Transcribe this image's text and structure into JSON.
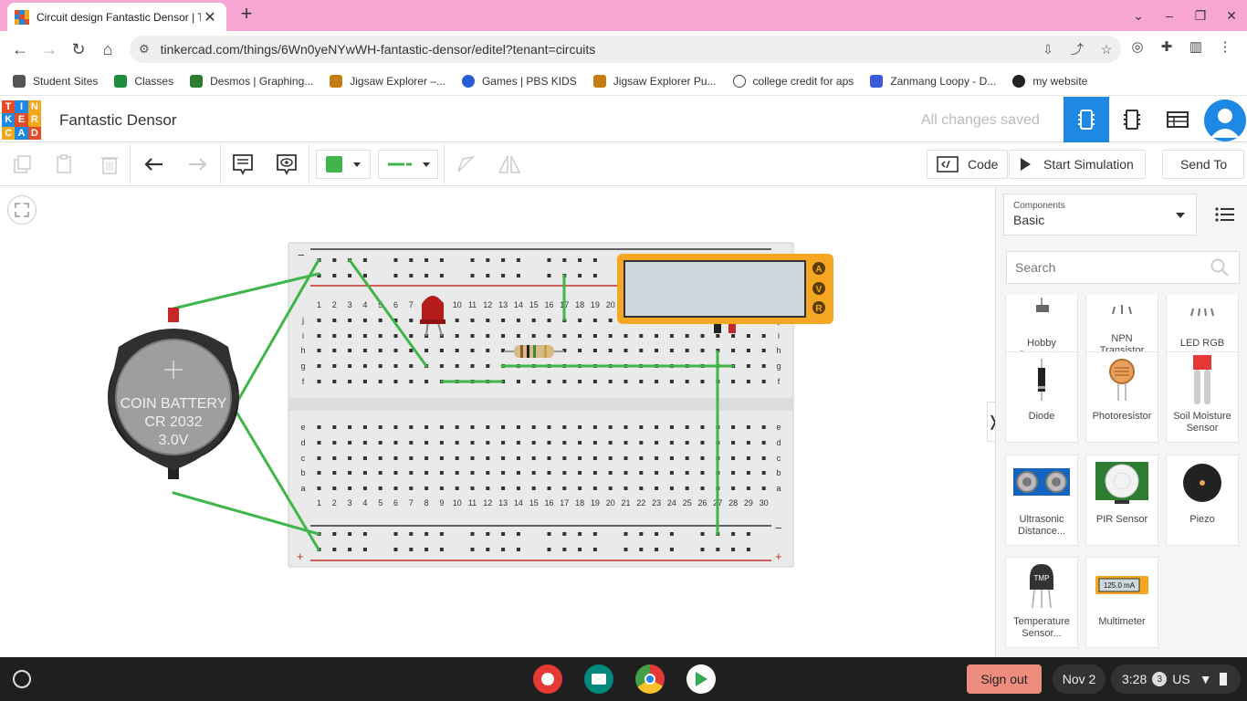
{
  "browser": {
    "tab_title": "Circuit design Fantastic Densor | Tinkercad",
    "url": "tinkercad.com/things/6Wn0yeNYwWH-fantastic-densor/editel?tenant=circuits",
    "bookmarks": [
      {
        "label": "Student Sites",
        "color": "#555"
      },
      {
        "label": "Classes",
        "color": "#1e8e3e"
      },
      {
        "label": "Desmos | Graphing...",
        "color": "#2e7d32"
      },
      {
        "label": "Jigsaw Explorer –...",
        "color": "#c77c14"
      },
      {
        "label": "Games | PBS KIDS",
        "color": "#2a5bd7"
      },
      {
        "label": "Jigsaw Explorer Pu...",
        "color": "#c77c14"
      },
      {
        "label": "college credit for aps",
        "color": "#444"
      },
      {
        "label": "Zanmang Loopy - D...",
        "color": "#3b5bdb"
      },
      {
        "label": "my website",
        "color": "#222"
      }
    ]
  },
  "app": {
    "logo_letters": [
      "T",
      "I",
      "N",
      "K",
      "E",
      "R",
      "C",
      "A",
      "D"
    ],
    "logo_colors": [
      "#e34c26",
      "#1e88e5",
      "#f2a71b",
      "#1e88e5",
      "#e34c26",
      "#f2a71b",
      "#f2a71b",
      "#1e88e5",
      "#e34c26"
    ],
    "design_name": "Fantastic Densor",
    "save_status": "All changes saved"
  },
  "toolbar": {
    "code_label": "Code",
    "start_sim_label": "Start Simulation",
    "send_to_label": "Send To",
    "wire_color": "#3fb54a"
  },
  "panel": {
    "components_label": "Components",
    "components_value": "Basic",
    "search_placeholder": "Search",
    "items": [
      {
        "label": "Hobby Gearmotor",
        "icon": "gearmotor-icon"
      },
      {
        "label": "NPN Transistor (BJT)",
        "icon": "transistor-icon"
      },
      {
        "label": "LED RGB",
        "icon": "rgb-led-icon"
      },
      {
        "label": "Diode",
        "icon": "diode-icon"
      },
      {
        "label": "Photoresistor",
        "icon": "photoresistor-icon"
      },
      {
        "label": "Soil Moisture Sensor",
        "icon": "soil-sensor-icon"
      },
      {
        "label": "Ultrasonic Distance...",
        "icon": "ultrasonic-icon"
      },
      {
        "label": "PIR Sensor",
        "icon": "pir-icon"
      },
      {
        "label": "Piezo",
        "icon": "piezo-icon"
      },
      {
        "label": "Temperature Sensor...",
        "icon": "tmp-sensor-icon"
      },
      {
        "label": "Multimeter",
        "icon": "multimeter-icon"
      }
    ],
    "tmp_chip_text": "TMP",
    "meter_icon_text": "125.0 mA"
  },
  "circuit": {
    "battery_line1": "COIN BATTERY",
    "battery_line2": "CR 2032",
    "battery_line3": "3.0V",
    "multimeter_modes": [
      "A",
      "V",
      "R"
    ],
    "breadboard_rows_top": [
      "j",
      "i",
      "h",
      "g",
      "f"
    ],
    "breadboard_rows_bottom": [
      "e",
      "d",
      "c",
      "b",
      "a"
    ],
    "rail_minus": "−",
    "rail_plus": "+"
  },
  "taskbar": {
    "sign_out": "Sign out",
    "date": "Nov 2",
    "time": "3:28",
    "notification_count": "3",
    "locale": "US"
  }
}
